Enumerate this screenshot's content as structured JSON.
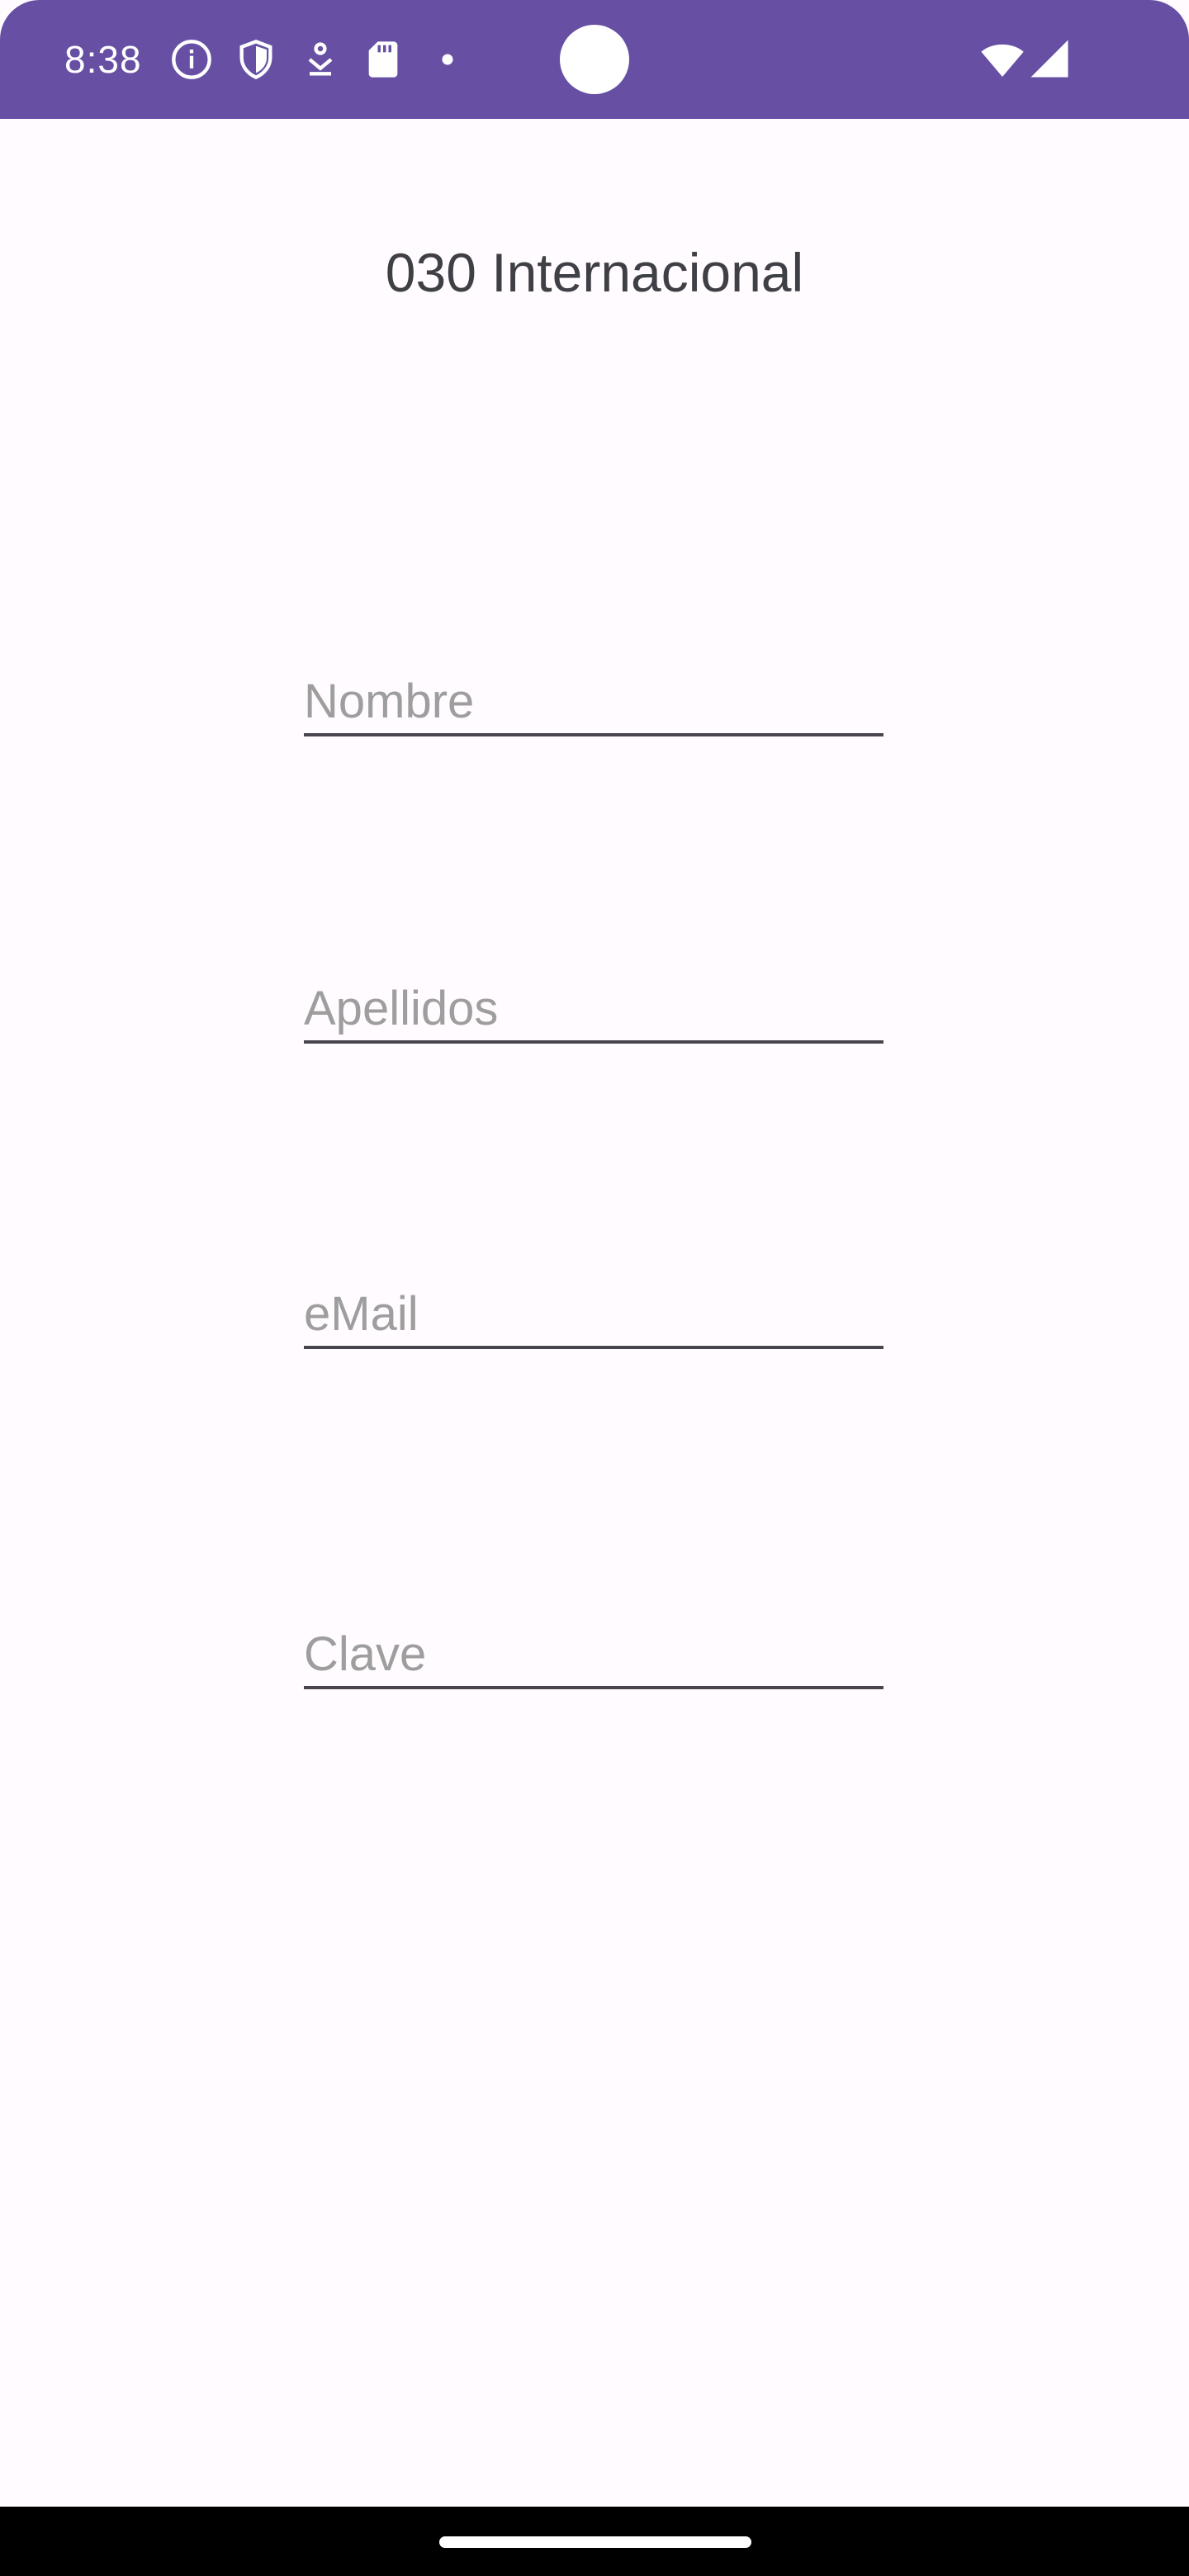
{
  "status_bar": {
    "time": "8:38",
    "background_color": "#6750a4",
    "left_icons": [
      "info-icon",
      "shield-icon",
      "download-icon",
      "sd-card-icon",
      "dot-icon"
    ],
    "right_icons": [
      "wifi-icon",
      "cell-signal-icon"
    ]
  },
  "app": {
    "title": "030 Internacional"
  },
  "form": {
    "nombre_placeholder": "Nombre",
    "nombre_value": "",
    "apellidos_placeholder": "Apellidos",
    "apellidos_value": "",
    "email_placeholder": "eMail",
    "email_value": "",
    "clave_placeholder": "Clave",
    "clave_value": ""
  }
}
